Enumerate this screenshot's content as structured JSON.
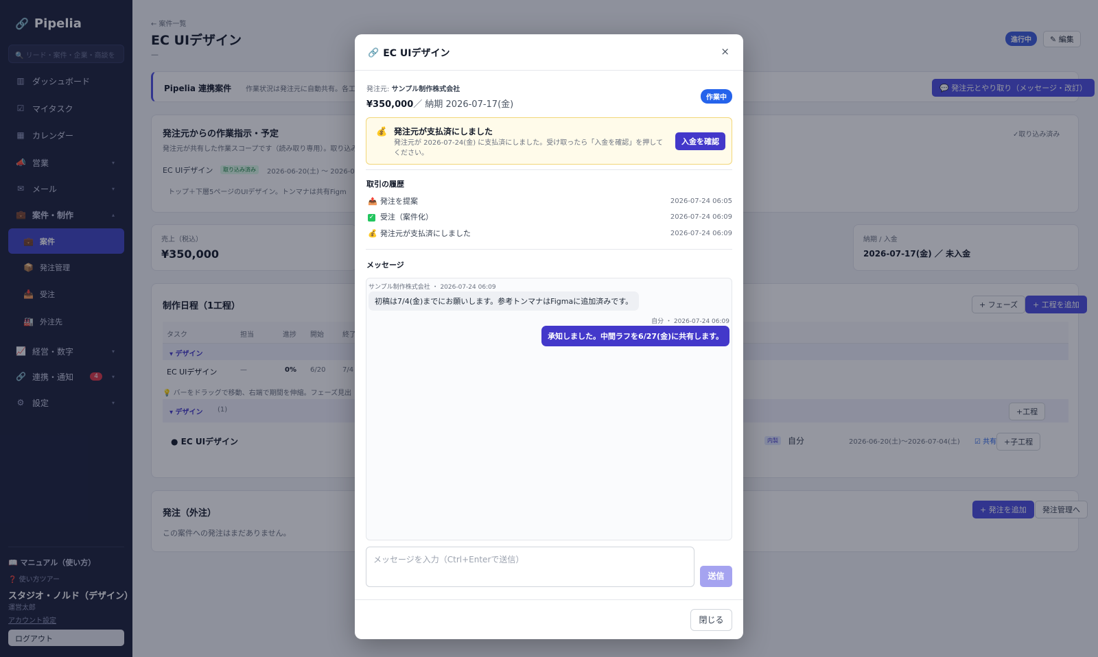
{
  "sidebar": {
    "brand": "Pipelia",
    "search_placeholder": "リード・案件・企業・商談を",
    "items": [
      {
        "label": "ダッシュボード"
      },
      {
        "label": "マイタスク"
      },
      {
        "label": "カレンダー"
      },
      {
        "label": "営業"
      },
      {
        "label": "メール"
      },
      {
        "label": "案件・制作"
      },
      {
        "label": "案件"
      },
      {
        "label": "発注管理"
      },
      {
        "label": "受注"
      },
      {
        "label": "外注先"
      },
      {
        "label": "経営・数字"
      },
      {
        "label": "連携・通知",
        "badge": "4"
      },
      {
        "label": "設定"
      }
    ],
    "manual": "マニュアル（使い方）",
    "tour": "使い方ツアー",
    "org": "スタジオ・ノルド（デザイン）",
    "user": "運営太郎",
    "account": "アカウント設定",
    "logout": "ログアウト"
  },
  "page": {
    "breadcrumb": "← 案件一覧",
    "title": "EC UIデザイン",
    "subtitle": "—",
    "status": "進行中",
    "edit": "✎ 編集",
    "banner_title": "Pipelia 連携案件",
    "banner_text": "作業状況は発注元に自動共有。各工程",
    "banner_button": "💬 発注元とやり取り（メッセージ・改訂）",
    "instructions_title": "発注元からの作業指示・予定",
    "instructions_sub": "発注元が共有した作業スコープです（読み取り専用）。取り込み",
    "imported": "✓取り込み済み",
    "scope_name": "EC UIデザイン",
    "scope_tag": "取り込み済み",
    "scope_dates": "2026-06-20(土) 〜 2026-07-",
    "scope_note": "トップ＋下層5ページのUIデザイン。トンマナは共有Figm",
    "sales_label": "売上（税込）",
    "sales_value": "¥350,000",
    "due_label": "納期 / 入金",
    "due_value": "2026-07-17(金) ／ 未入金",
    "schedule_title": "制作日程（1工程）",
    "phase_button": "+ フェーズ",
    "add_process_button": "+ 工程を追加",
    "table_headers": [
      "タスク",
      "担当",
      "進捗",
      "開始",
      "終了"
    ],
    "group_design": "デザイン",
    "task_name": "EC UIデザイン",
    "task_owner": "—",
    "task_progress": "0%",
    "task_start": "6/20",
    "task_end": "7/4",
    "hint": "💡 バーをドラッグで移動、右端で期間を伸縮。フェーズ見出",
    "group_design2": "デザイン",
    "group_count": "(1)",
    "add_child": "+工程",
    "task2_name": "EC UIデザイン",
    "task2_tag": "内製",
    "task2_owner": "自分",
    "task2_dates": "2026-06-20(土)〜2026-07-04(土)",
    "task2_share": "共有",
    "child_button": "+子工程",
    "outsource_title": "発注（外注）",
    "outsource_empty": "この案件への発注はまだありません。",
    "add_order": "+ 発注を追加",
    "order_mgmt": "発注管理へ"
  },
  "modal": {
    "title": "EC UIデザイン",
    "close_icon": "×",
    "from_label": "発注元:",
    "from_value": "サンプル制作株式会社",
    "amount": "¥350,000",
    "due": "／ 納期 2026-07-17(金)",
    "badge": "作業中",
    "alert_title": "発注元が支払済にしました",
    "alert_text": "発注元が 2026-07-24(金) に支払済にしました。受け取ったら「入金を確認」を押してください。",
    "alert_button": "入金を確認",
    "history_title": "取引の履歴",
    "history": [
      {
        "icon": "📤",
        "label": "発注を提案",
        "time": "2026-07-24 06:05"
      },
      {
        "icon": "✓",
        "label": "受注（案件化）",
        "time": "2026-07-24 06:09"
      },
      {
        "icon": "💰",
        "label": "発注元が支払済にしました",
        "time": "2026-07-24 06:09"
      }
    ],
    "messages_title": "メッセージ",
    "msg1_meta": "サンプル制作株式会社 ・ 2026-07-24 06:09",
    "msg1_text": "初稿は7/4(金)までにお願いします。参考トンマナはFigmaに追加済みです。",
    "msg2_meta": "自分 ・ 2026-07-24 06:09",
    "msg2_text": "承知しました。中間ラフを6/27(金)に共有します。",
    "input_placeholder": "メッセージを入力（Ctrl+Enterで送信）",
    "send": "送信",
    "close": "閉じる"
  },
  "colors": {
    "sidebar_bg": "#1a1f3a",
    "accent": "#4338ca",
    "status_blue": "#2563eb",
    "alert_bg": "#fffbea"
  }
}
